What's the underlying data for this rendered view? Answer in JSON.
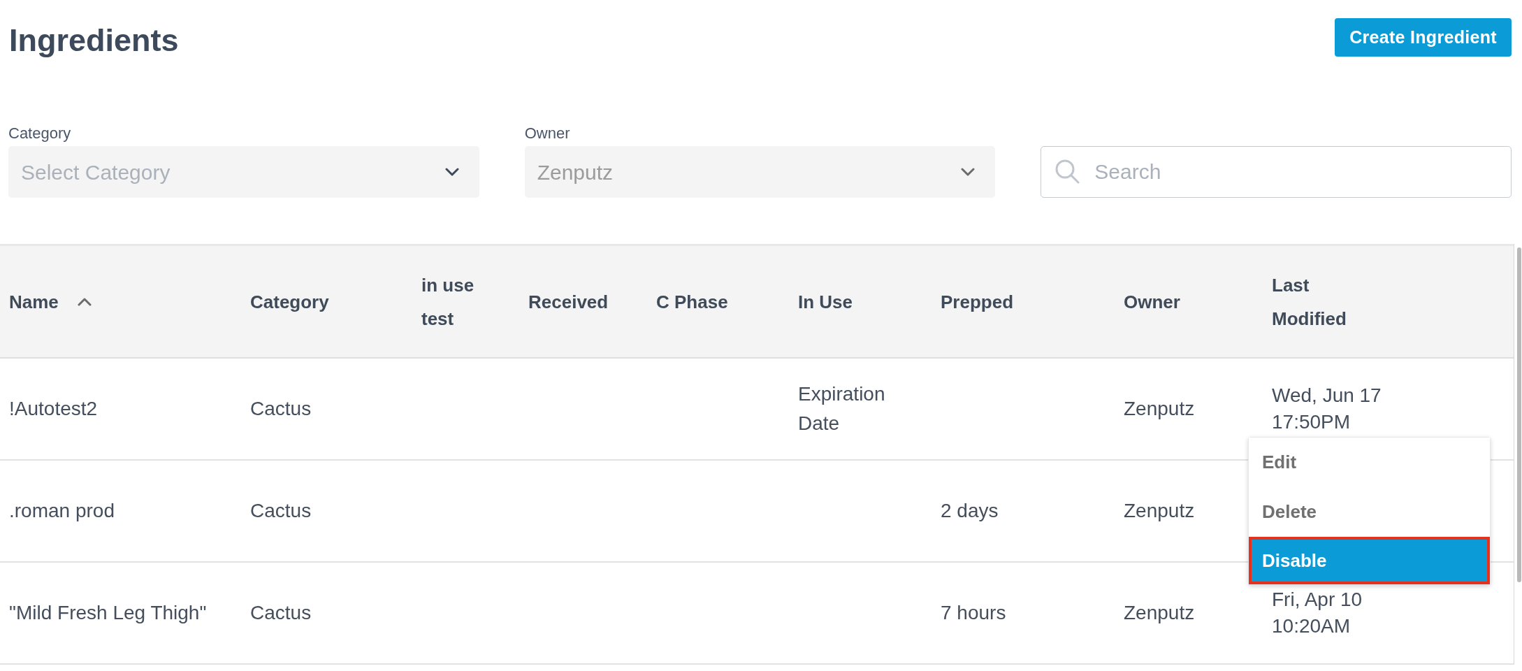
{
  "page": {
    "title": "Ingredients",
    "create_button": "Create Ingredient"
  },
  "filters": [
    {
      "label": "Category",
      "placeholder": "Select Category",
      "disabled": false
    },
    {
      "label": "Owner",
      "value": "Zenputz",
      "disabled": true
    }
  ],
  "search": {
    "placeholder": "Search"
  },
  "table": {
    "columns": [
      {
        "label": "Name",
        "sorted": true
      },
      {
        "label": "Category",
        "sorted": false
      },
      {
        "label": "in use test",
        "sorted": false
      },
      {
        "label": "Received",
        "sorted": false
      },
      {
        "label": "C Phase",
        "sorted": false
      },
      {
        "label": "In Use",
        "sorted": false
      },
      {
        "label": "Prepped",
        "sorted": false
      },
      {
        "label": "Owner",
        "sorted": false
      },
      {
        "label": "Last Modified",
        "sorted": false
      }
    ],
    "rows": [
      {
        "name": "!Autotest2",
        "category": "Cactus",
        "in_use": "Expiration Date",
        "owner": "Zenputz",
        "last_modified": "Wed, Jun 17 17:50PM"
      },
      {
        "name": ".roman prod",
        "category": "Cactus",
        "prepped": "2 days",
        "owner": "Zenputz"
      },
      {
        "name": "\"Mild Fresh Leg Thigh\"",
        "category": "Cactus",
        "prepped": "7 hours",
        "owner": "Zenputz",
        "last_modified": "Fri, Apr 10 10:20AM"
      }
    ]
  },
  "row_menu": {
    "items": [
      {
        "label": "Edit",
        "selected": false
      },
      {
        "label": "Delete",
        "selected": false
      },
      {
        "label": "Disable",
        "selected": true
      }
    ]
  }
}
